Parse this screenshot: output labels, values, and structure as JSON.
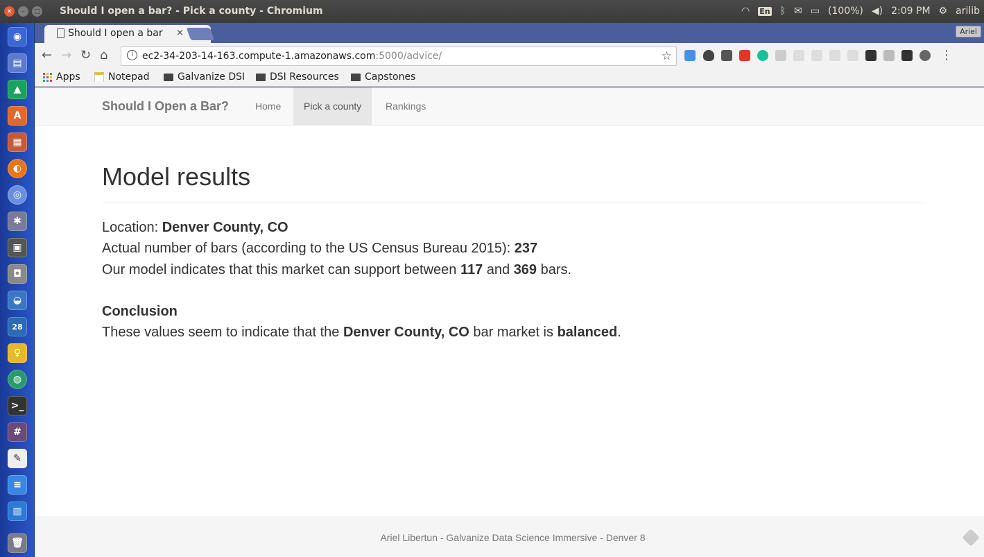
{
  "system": {
    "window_title": "Should I open a bar? - Pick a county - Chromium",
    "lang": "En",
    "battery": "(100%)",
    "time": "2:09 PM",
    "user": "arilib"
  },
  "browser": {
    "tab_title": "Should I open a bar",
    "tab_close": "×",
    "profile": "Ariel",
    "url_host": "ec2-34-203-14-163.compute-1.amazonaws.com",
    "url_rest": ":5000/advice/",
    "bookmarks": [
      {
        "label": "Apps",
        "icon": "apps-grid-icon"
      },
      {
        "label": "Notepad",
        "icon": "notepad-icon"
      },
      {
        "label": "Galvanize DSI",
        "icon": "folder-icon"
      },
      {
        "label": "DSI Resources",
        "icon": "folder-icon"
      },
      {
        "label": "Capstones",
        "icon": "folder-icon"
      }
    ]
  },
  "page": {
    "brand": "Should I Open a Bar?",
    "nav": [
      "Home",
      "Pick a county",
      "Rankings"
    ],
    "active_nav": "Pick a county",
    "heading": "Model results",
    "location_label": "Location: ",
    "location": "Denver County, CO",
    "actual_label": "Actual number of bars (according to the US Census Bureau 2015): ",
    "actual_value": "237",
    "model_prefix": "Our model indicates that this market can support between ",
    "model_low": "117",
    "model_mid": " and ",
    "model_high": "369",
    "model_suffix": " bars.",
    "conclusion_heading": "Conclusion",
    "conclusion_prefix": "These values seem to indicate that the ",
    "conclusion_location": "Denver County, CO",
    "conclusion_mid": " bar market is ",
    "conclusion_status": "balanced",
    "conclusion_suffix": ".",
    "footer": "Ariel Libertun - Galvanize Data Science Immersive - Denver 8"
  },
  "colors": {
    "desktop": "#2c2c6e",
    "launcher": "#2a56c6",
    "tabstrip": "#4a5d9d",
    "close_button": "#e05e35"
  }
}
